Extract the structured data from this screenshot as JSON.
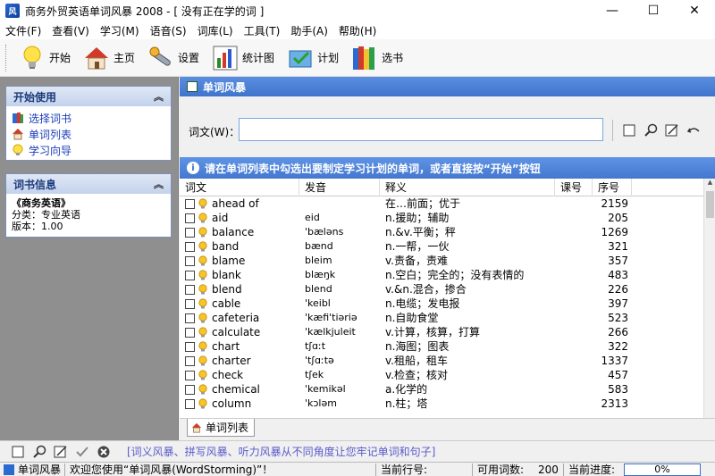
{
  "window": {
    "title": "商务外贸英语单词风暴 2008 - [ 没有正在学的词 ]",
    "app_icon_text": "风"
  },
  "menu": [
    "文件(F)",
    "查看(V)",
    "学习(M)",
    "语音(S)",
    "词库(L)",
    "工具(T)",
    "助手(A)",
    "帮助(H)"
  ],
  "toolbar": {
    "start": "开始",
    "home": "主页",
    "settings": "设置",
    "stats": "统计图",
    "plan": "计划",
    "choose_book": "选书"
  },
  "sidebar": {
    "start_panel": {
      "title": "开始使用",
      "links": [
        "选择词书",
        "单词列表",
        "学习向导"
      ]
    },
    "book_panel": {
      "title": "词书信息",
      "book_name": "《商务英语》",
      "category": "分类：专业英语",
      "version": "版本：1.00"
    }
  },
  "main": {
    "section_title": "单词风暴",
    "word_label": "词文(W)：",
    "word_value": "",
    "info_text": "请在单词列表中勾选出要制定学习计划的单词，或者直接按“开始”按钮",
    "columns": [
      "词文",
      "发音",
      "释义",
      "课号",
      "序号"
    ],
    "rows": [
      {
        "word": "ahead of",
        "ph": "",
        "def": "在…前面；优于",
        "lesson": "",
        "num": "2159"
      },
      {
        "word": "aid",
        "ph": "eid",
        "def": "n.援助；辅助",
        "lesson": "",
        "num": "205"
      },
      {
        "word": "balance",
        "ph": "'bæləns",
        "def": "n.&v.平衡；秤",
        "lesson": "",
        "num": "1269"
      },
      {
        "word": "band",
        "ph": "bænd",
        "def": "n.一帮，一伙",
        "lesson": "",
        "num": "321"
      },
      {
        "word": "blame",
        "ph": "bleim",
        "def": "v.责备，责难",
        "lesson": "",
        "num": "357"
      },
      {
        "word": "blank",
        "ph": "blæŋk",
        "def": "n.空白；完全的；没有表情的",
        "lesson": "",
        "num": "483"
      },
      {
        "word": "blend",
        "ph": "blend",
        "def": "v.&n.混合，掺合",
        "lesson": "",
        "num": "226"
      },
      {
        "word": "cable",
        "ph": "'keibl",
        "def": "n.电缆；发电报",
        "lesson": "",
        "num": "397"
      },
      {
        "word": "cafeteria",
        "ph": "'kæfi'tiəriə",
        "def": "n.自助食堂",
        "lesson": "",
        "num": "523"
      },
      {
        "word": "calculate",
        "ph": "'kælkjuleit",
        "def": "v.计算，核算，打算",
        "lesson": "",
        "num": "266"
      },
      {
        "word": "chart",
        "ph": "tʃɑːt",
        "def": "n.海图；图表",
        "lesson": "",
        "num": "322"
      },
      {
        "word": "charter",
        "ph": "'tʃɑːtə",
        "def": "v.租船，租车",
        "lesson": "",
        "num": "1337"
      },
      {
        "word": "check",
        "ph": "tʃek",
        "def": "v.检查；核对",
        "lesson": "",
        "num": "457"
      },
      {
        "word": "chemical",
        "ph": "'kemikəl",
        "def": "a.化学的",
        "lesson": "",
        "num": "583"
      },
      {
        "word": "column",
        "ph": "'kɔləm",
        "def": "n.柱；塔",
        "lesson": "",
        "num": "2313"
      }
    ],
    "tab_label": "单词列表"
  },
  "bottombar": {
    "hint": "[词义风暴、拼写风暴、听力风暴从不同角度让您牢记单词和句子]"
  },
  "statusbar": {
    "app": "单词风暴",
    "welcome": "欢迎您使用“单词风暴(WordStorming)”！",
    "current_row_label": "当前行号:",
    "current_row_value": "",
    "available_label": "可用词数:",
    "available_value": "200",
    "progress_label": "当前进度:",
    "progress_value": "0%"
  },
  "colors": {
    "accent": "#4478d0",
    "link": "#1a3cb8",
    "sidebar_bg": "#8f8f8f"
  }
}
